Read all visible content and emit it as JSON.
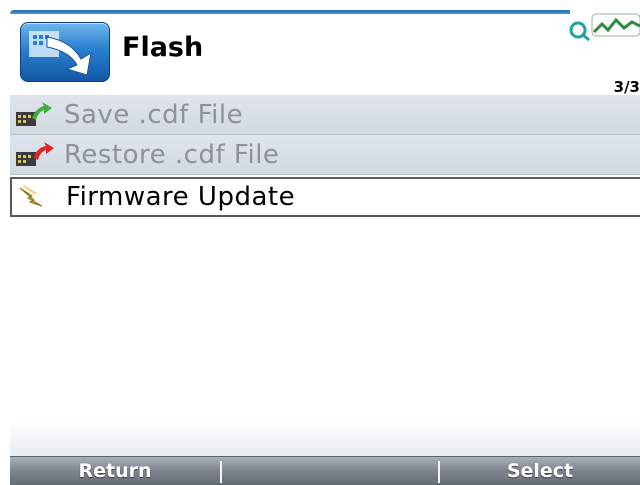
{
  "header": {
    "title": "Flash",
    "counter": "3/3"
  },
  "menu": {
    "items": [
      {
        "label": "Save .cdf File",
        "icon": "save-file-icon"
      },
      {
        "label": "Restore .cdf File",
        "icon": "restore-file-icon"
      },
      {
        "label": "Firmware Update",
        "icon": "lightning-icon"
      }
    ],
    "selected_index": 2
  },
  "softkeys": {
    "left": "Return",
    "center": "",
    "right": "Select"
  },
  "colors": {
    "accent": "#1c6fb0",
    "item_bg": "#d8dee6",
    "disabled_text": "#8d9198",
    "softkey_bar": "#7d838d"
  }
}
